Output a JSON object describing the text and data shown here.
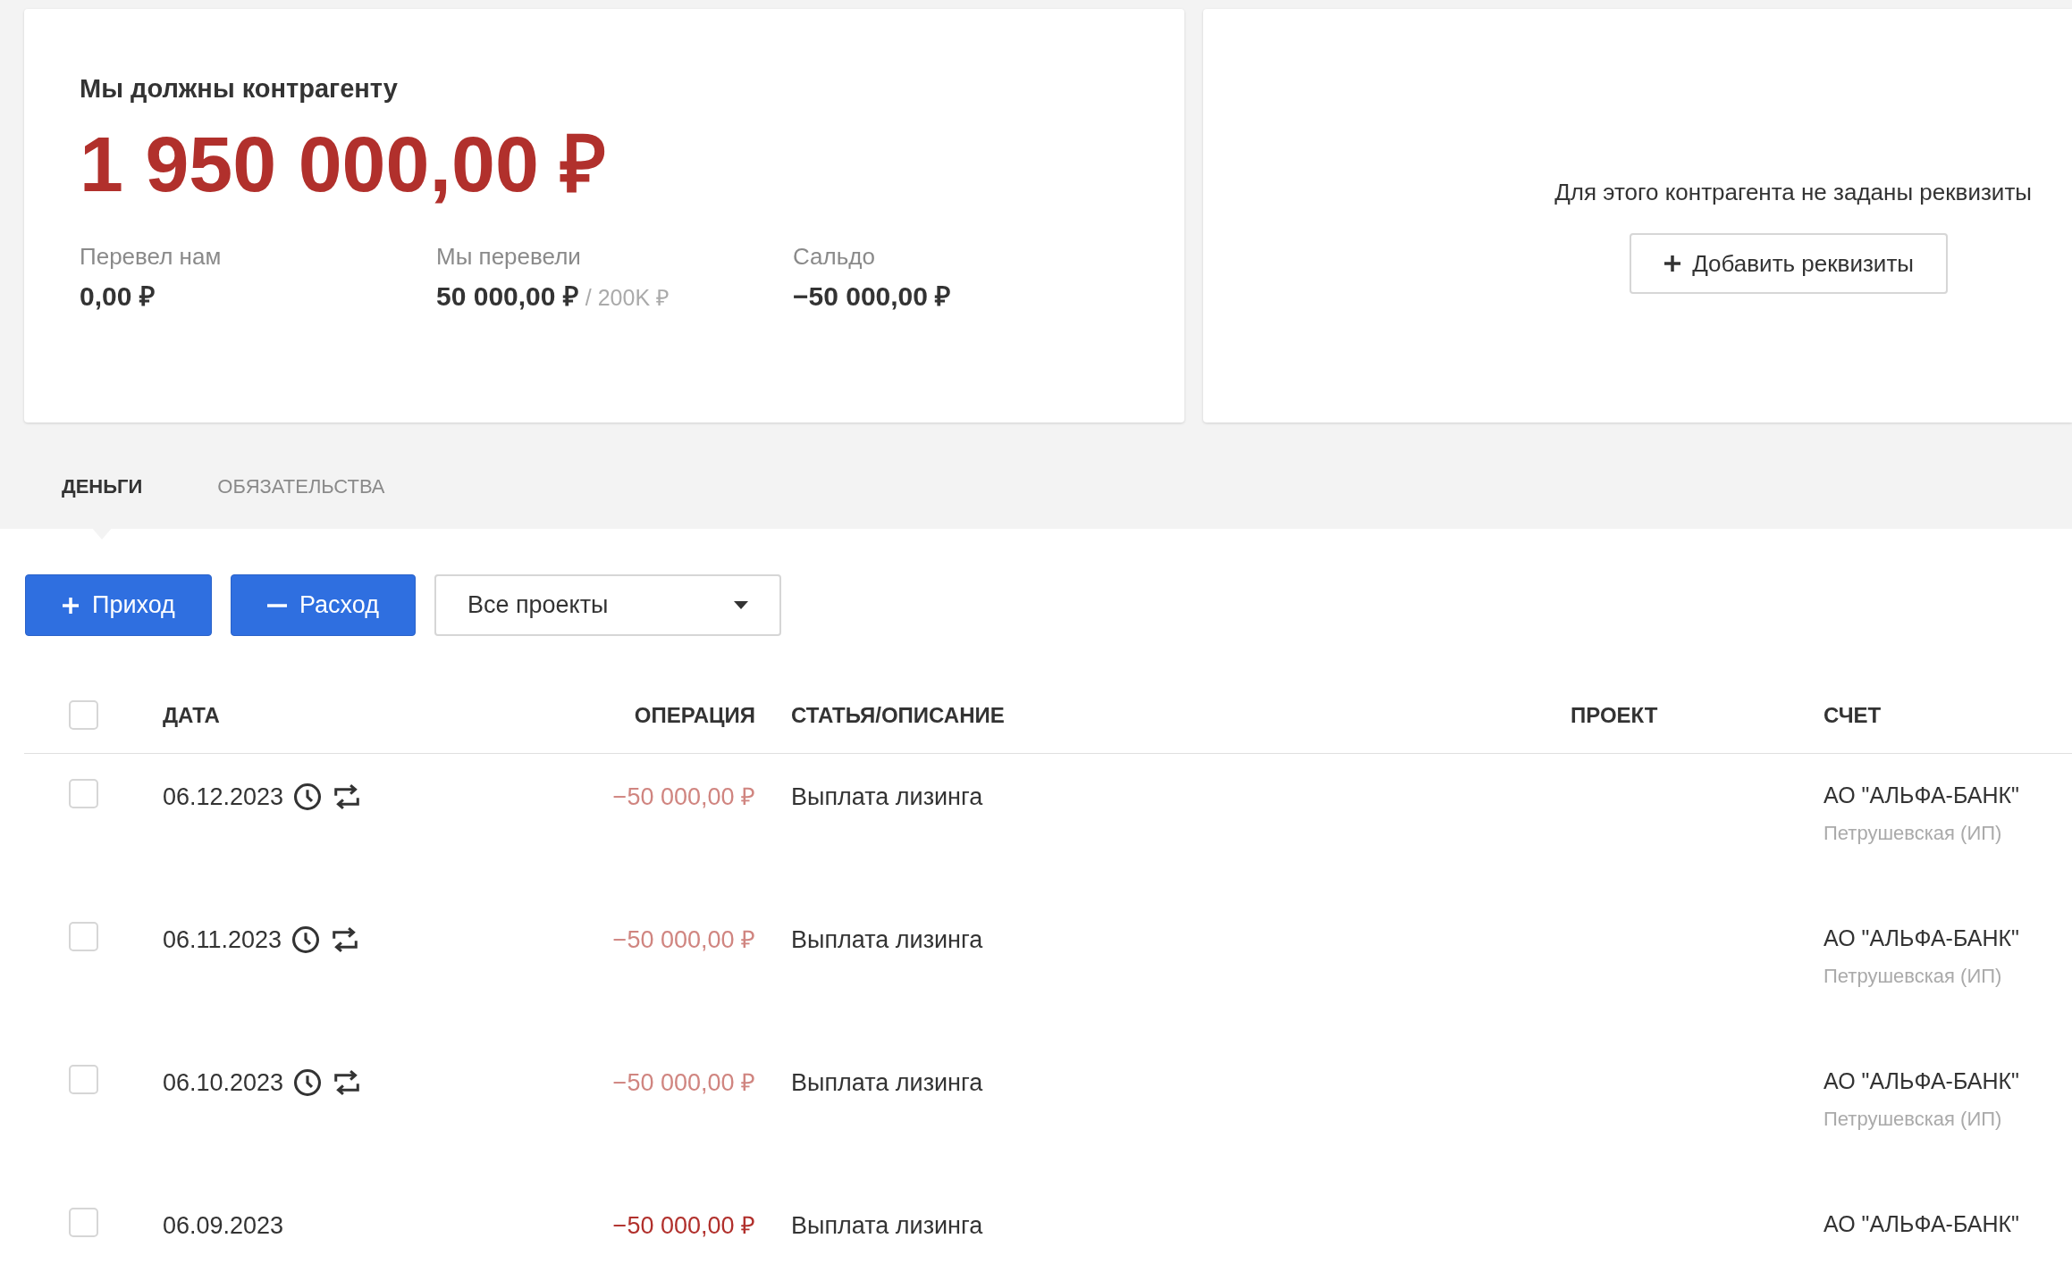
{
  "summary": {
    "title": "Мы должны контрагенту",
    "amount": "1 950 000,00 ₽",
    "stats": [
      {
        "label": "Перевел нам",
        "value": "0,00 ₽"
      },
      {
        "label": "Мы перевели",
        "value": "50 000,00 ₽",
        "limit": "/ 200K ₽"
      },
      {
        "label": "Сальдо",
        "value": "−50 000,00 ₽"
      }
    ]
  },
  "requisites": {
    "message": "Для этого контрагента не заданы реквизиты",
    "button": "Добавить реквизиты"
  },
  "tabs": [
    {
      "label": "ДЕНЬГИ",
      "selected": true
    },
    {
      "label": "ОБЯЗАТЕЛЬСТВА",
      "selected": false
    }
  ],
  "toolbar": {
    "buttons": [
      {
        "kind": "income",
        "label": "Приход"
      },
      {
        "kind": "expense",
        "label": "Расход"
      }
    ],
    "project_select": "Все проекты"
  },
  "table": {
    "select_all": false,
    "columns": [
      "ДАТА",
      "ОПЕРАЦИЯ",
      "СТАТЬЯ/ОПИСАНИЕ",
      "ПРОЕКТ",
      "СЧЕТ"
    ],
    "rows": [
      {
        "checked": false,
        "date": "06.12.2023",
        "planned": true,
        "recurring": true,
        "amount": "−50 000,00 ₽",
        "description": "Выплата лизинга",
        "account": "АО \"АЛЬФА-БАНК\"",
        "account_owner": "Петрушевская (ИП)"
      },
      {
        "checked": false,
        "date": "06.11.2023",
        "planned": true,
        "recurring": true,
        "amount": "−50 000,00 ₽",
        "description": "Выплата лизинга",
        "account": "АО \"АЛЬФА-БАНК\"",
        "account_owner": "Петрушевская (ИП)"
      },
      {
        "checked": false,
        "date": "06.10.2023",
        "planned": true,
        "recurring": true,
        "amount": "−50 000,00 ₽",
        "description": "Выплата лизинга",
        "account": "АО \"АЛЬФА-БАНК\"",
        "account_owner": "Петрушевская (ИП)"
      },
      {
        "checked": false,
        "date": "06.09.2023",
        "planned": false,
        "recurring": false,
        "amount": "−50 000,00 ₽",
        "description": "Выплата лизинга",
        "account": "АО \"АЛЬФА-БАНК\""
      }
    ]
  }
}
